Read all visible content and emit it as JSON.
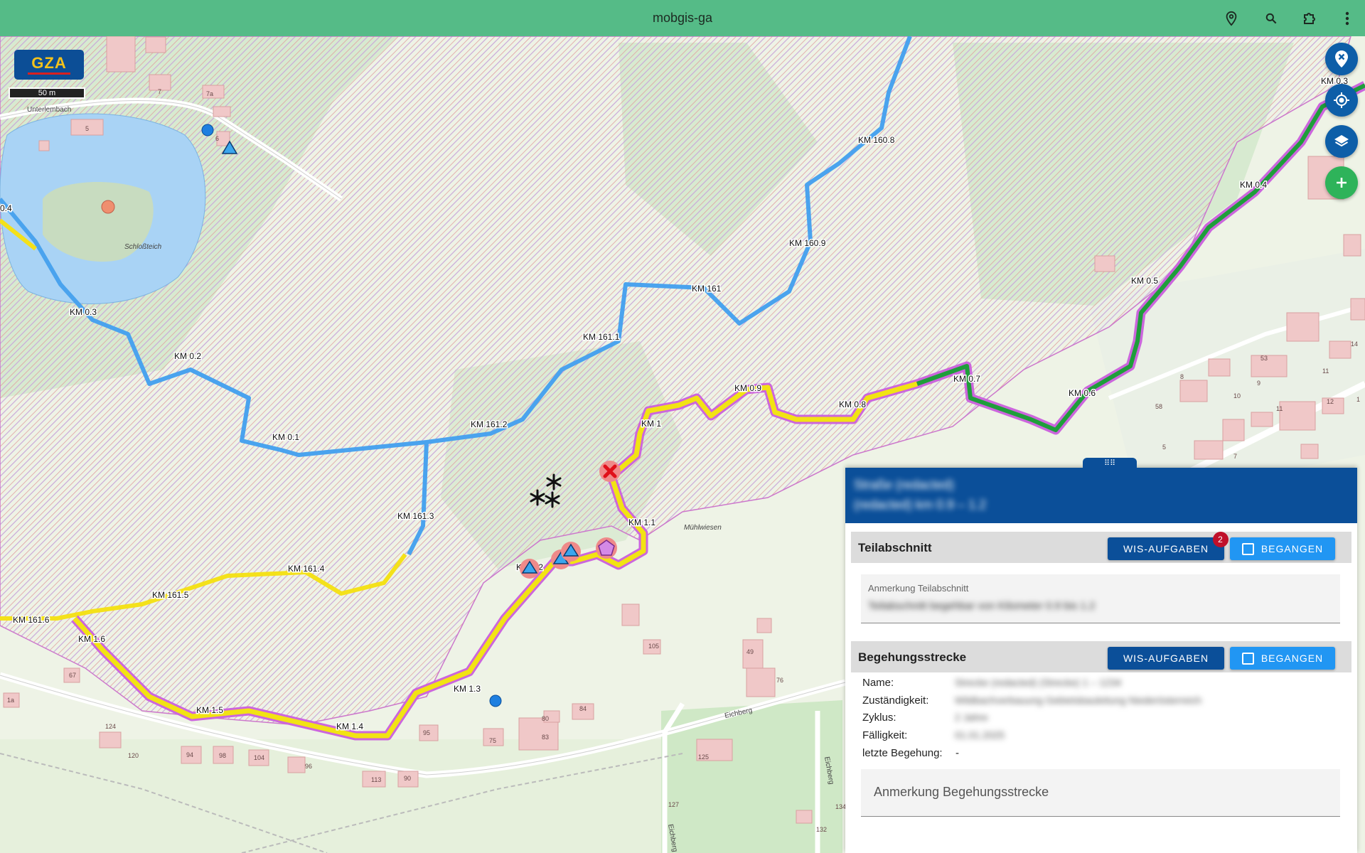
{
  "app": {
    "title": "mobgis-ga"
  },
  "toolbar": {
    "icons": [
      "location-pin-icon",
      "search-icon",
      "extension-icon",
      "more-vert-icon"
    ]
  },
  "map": {
    "logo_text": "GZA",
    "scale_label": "50 m",
    "km_labels": {
      "blue": [
        "KM 160.8",
        "KM 160.9",
        "KM 161",
        "KM 161.1",
        "KM 161.2",
        "KM 161.3"
      ],
      "blue_left": [
        "KM 0.3",
        "KM 0.2",
        "KM 0.1"
      ],
      "yellow_left": [
        "KM 161.4",
        "KM 161.5",
        "KM 161.6",
        "KM 1.6"
      ],
      "route": [
        "KM 1.5",
        "KM 1.4",
        "KM 1.3",
        "KM 1.2",
        "KM 1.1",
        "KM 1",
        "KM 0.9",
        "KM 0.8",
        "KM 0.7",
        "KM 0.6",
        "KM 0.5",
        "KM 0.4",
        "KM 0.3"
      ],
      "edge_left": "0.4"
    },
    "place_names": {
      "pond": "Schloßteich",
      "street1": "Unterlembach",
      "street2": "Eichberg",
      "street3": "Eichberg",
      "street4": "Eichberg",
      "meadow": "Mühlwiesen"
    },
    "house_numbers": [
      "7",
      "7a",
      "5",
      "6",
      "67",
      "1a",
      "124",
      "120",
      "94",
      "98",
      "104",
      "96",
      "113",
      "90",
      "95",
      "80",
      "75",
      "84",
      "83",
      "105",
      "49",
      "76",
      "125",
      "127",
      "134",
      "132",
      "53",
      "11",
      "9",
      "8",
      "58",
      "10",
      "7",
      "5",
      "12",
      "11",
      "14",
      "1"
    ]
  },
  "fabs": [
    "close-location-icon",
    "my-location-icon",
    "layers-icon",
    "add-icon"
  ],
  "panel": {
    "header_line1": "Straße (redacted)",
    "header_line2": "(redacted) km 0.9 – 1.2",
    "teilabschnitt": {
      "title": "Teilabschnitt",
      "wis_button": "WIS-AUFGABEN",
      "wis_badge": "2",
      "begangen_button": "BEGANGEN",
      "note_label": "Anmerkung Teilabschnitt",
      "note_value": "Teilabschnitt begehbar von Kilometer 0.9 bis 1.2"
    },
    "begehungsstrecke": {
      "title": "Begehungsstrecke",
      "wis_button": "WIS-AUFGABEN",
      "begangen_button": "BEGANGEN",
      "rows": [
        {
          "label": "Name:",
          "value": "Strecke (redacted) (Strecke) 1 – 1234"
        },
        {
          "label": "Zuständigkeit:",
          "value": "Wildbachverbauung Gebietsbauleitung Niederösterreich"
        },
        {
          "label": "Zyklus:",
          "value": "2 Jahre"
        },
        {
          "label": "Fälligkeit:",
          "value": "01.01.2025"
        },
        {
          "label": "letzte Begehung:",
          "value": "-"
        }
      ],
      "note_placeholder": "Anmerkung Begehungsstrecke"
    }
  },
  "colors": {
    "header_bg": "#55bb87",
    "panel_blue": "#0b4f99",
    "button_light": "#2196f3",
    "route_yellow": "#f2e313",
    "route_green": "#1e9e3a",
    "route_purple": "#cc66dd",
    "stream_blue": "#4aa3ee"
  }
}
